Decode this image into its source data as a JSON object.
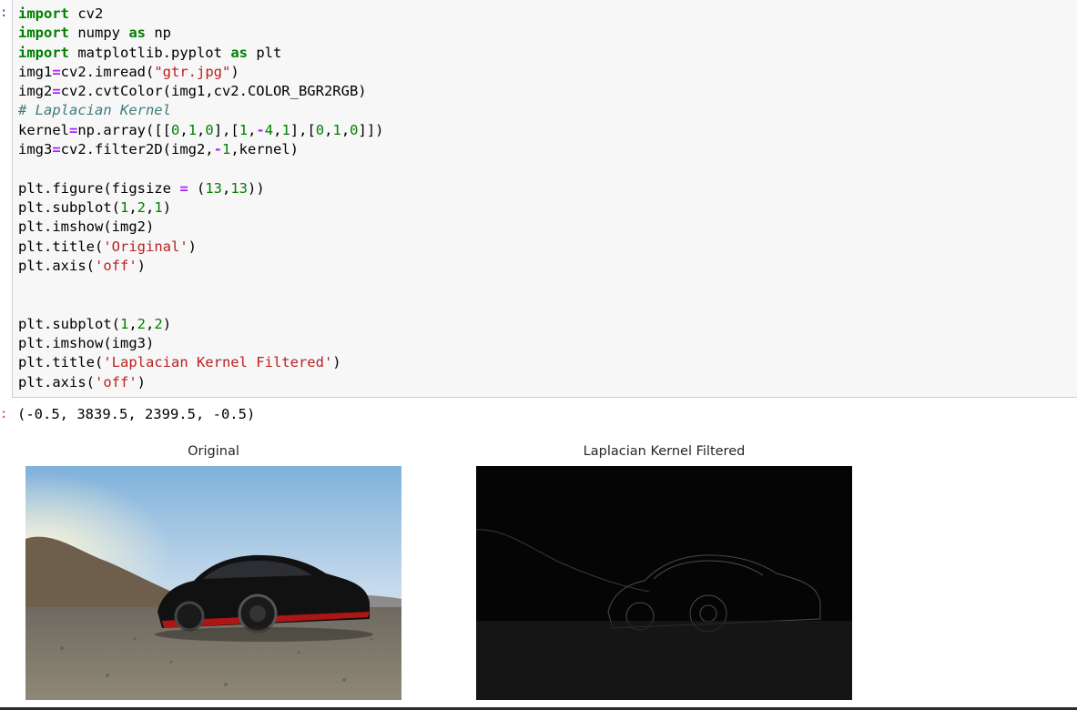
{
  "prompts": {
    "input": ":",
    "output": ":"
  },
  "code_lines": [
    [
      {
        "t": "import",
        "c": "kw"
      },
      {
        "t": " cv2",
        "c": ""
      }
    ],
    [
      {
        "t": "import",
        "c": "kw"
      },
      {
        "t": " numpy ",
        "c": ""
      },
      {
        "t": "as",
        "c": "kw"
      },
      {
        "t": " np",
        "c": ""
      }
    ],
    [
      {
        "t": "import",
        "c": "kw"
      },
      {
        "t": " matplotlib.pyplot ",
        "c": ""
      },
      {
        "t": "as",
        "c": "kw"
      },
      {
        "t": " plt",
        "c": ""
      }
    ],
    [
      {
        "t": "img1",
        "c": ""
      },
      {
        "t": "=",
        "c": "op"
      },
      {
        "t": "cv2.imread(",
        "c": ""
      },
      {
        "t": "\"gtr.jpg\"",
        "c": "str"
      },
      {
        "t": ")",
        "c": ""
      }
    ],
    [
      {
        "t": "img2",
        "c": ""
      },
      {
        "t": "=",
        "c": "op"
      },
      {
        "t": "cv2.cvtColor(img1,cv2.COLOR_BGR2RGB)",
        "c": ""
      }
    ],
    [
      {
        "t": "# Laplacian Kernel",
        "c": "cm"
      }
    ],
    [
      {
        "t": "kernel",
        "c": ""
      },
      {
        "t": "=",
        "c": "op"
      },
      {
        "t": "np.array([[",
        "c": ""
      },
      {
        "t": "0",
        "c": "num"
      },
      {
        "t": ",",
        "c": ""
      },
      {
        "t": "1",
        "c": "num"
      },
      {
        "t": ",",
        "c": ""
      },
      {
        "t": "0",
        "c": "num"
      },
      {
        "t": "],[",
        "c": ""
      },
      {
        "t": "1",
        "c": "num"
      },
      {
        "t": ",",
        "c": ""
      },
      {
        "t": "-",
        "c": "op"
      },
      {
        "t": "4",
        "c": "num"
      },
      {
        "t": ",",
        "c": ""
      },
      {
        "t": "1",
        "c": "num"
      },
      {
        "t": "],[",
        "c": ""
      },
      {
        "t": "0",
        "c": "num"
      },
      {
        "t": ",",
        "c": ""
      },
      {
        "t": "1",
        "c": "num"
      },
      {
        "t": ",",
        "c": ""
      },
      {
        "t": "0",
        "c": "num"
      },
      {
        "t": "]])",
        "c": ""
      }
    ],
    [
      {
        "t": "img3",
        "c": ""
      },
      {
        "t": "=",
        "c": "op"
      },
      {
        "t": "cv2.filter2D(img2,",
        "c": ""
      },
      {
        "t": "-",
        "c": "op"
      },
      {
        "t": "1",
        "c": "num"
      },
      {
        "t": ",kernel)",
        "c": ""
      }
    ],
    [
      {
        "t": "",
        "c": ""
      }
    ],
    [
      {
        "t": "plt.figure(figsize ",
        "c": ""
      },
      {
        "t": "=",
        "c": "op"
      },
      {
        "t": " (",
        "c": ""
      },
      {
        "t": "13",
        "c": "num"
      },
      {
        "t": ",",
        "c": ""
      },
      {
        "t": "13",
        "c": "num"
      },
      {
        "t": "))",
        "c": ""
      }
    ],
    [
      {
        "t": "plt.subplot(",
        "c": ""
      },
      {
        "t": "1",
        "c": "num"
      },
      {
        "t": ",",
        "c": ""
      },
      {
        "t": "2",
        "c": "num"
      },
      {
        "t": ",",
        "c": ""
      },
      {
        "t": "1",
        "c": "num"
      },
      {
        "t": ")",
        "c": ""
      }
    ],
    [
      {
        "t": "plt.imshow(img2)",
        "c": ""
      }
    ],
    [
      {
        "t": "plt.title(",
        "c": ""
      },
      {
        "t": "'Original'",
        "c": "str"
      },
      {
        "t": ")",
        "c": ""
      }
    ],
    [
      {
        "t": "plt.axis(",
        "c": ""
      },
      {
        "t": "'off'",
        "c": "str"
      },
      {
        "t": ")",
        "c": ""
      }
    ],
    [
      {
        "t": "",
        "c": ""
      }
    ],
    [
      {
        "t": "",
        "c": ""
      }
    ],
    [
      {
        "t": "plt.subplot(",
        "c": ""
      },
      {
        "t": "1",
        "c": "num"
      },
      {
        "t": ",",
        "c": ""
      },
      {
        "t": "2",
        "c": "num"
      },
      {
        "t": ",",
        "c": ""
      },
      {
        "t": "2",
        "c": "num"
      },
      {
        "t": ")",
        "c": ""
      }
    ],
    [
      {
        "t": "plt.imshow(img3)",
        "c": ""
      }
    ],
    [
      {
        "t": "plt.title(",
        "c": ""
      },
      {
        "t": "'Laplacian Kernel Filtered'",
        "c": "str"
      },
      {
        "t": ")",
        "c": ""
      }
    ],
    [
      {
        "t": "plt.axis(",
        "c": ""
      },
      {
        "t": "'off'",
        "c": "str"
      },
      {
        "t": ")",
        "c": ""
      }
    ]
  ],
  "output": {
    "text": "(-0.5, 3839.5, 2399.5, -0.5)",
    "figure_titles": [
      "Original",
      "Laplacian Kernel Filtered"
    ]
  }
}
